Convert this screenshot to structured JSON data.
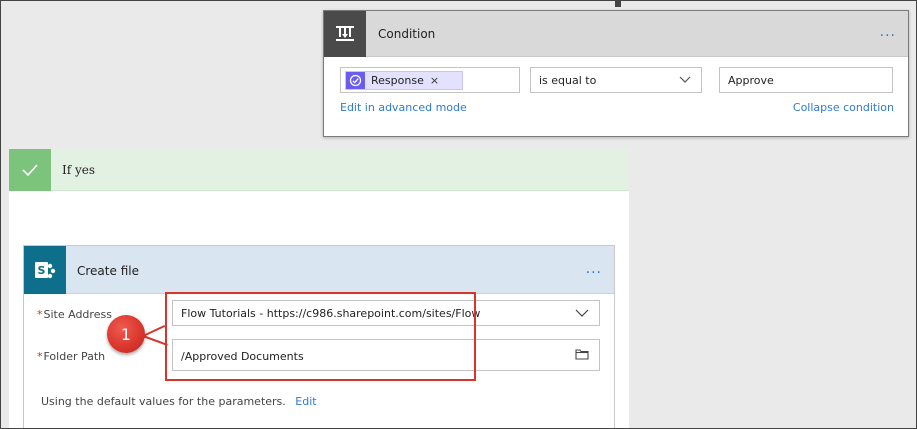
{
  "condition": {
    "title": "Condition",
    "token_label": "Response",
    "token_remove": "×",
    "operator": "is equal to",
    "value": "Approve",
    "edit_advanced_link": "Edit in advanced mode",
    "collapse_link": "Collapse condition",
    "more": "..."
  },
  "if_yes": {
    "label": "If yes"
  },
  "create_file": {
    "title": "Create file",
    "more": "...",
    "site_address_label": "Site Address",
    "site_address_value": "Flow Tutorials - https://c986.sharepoint.com/sites/Flow",
    "folder_path_label": "Folder Path",
    "folder_path_value": "/Approved Documents",
    "required_marker": "*",
    "defaults_note": "Using the default values for the parameters.",
    "edit_link": "Edit"
  },
  "callout": {
    "number": "1",
    "color": "#d9342b"
  },
  "colors": {
    "condition_header": "#d9d9d9",
    "ifyes_bar": "#e3f1e3",
    "ifyes_check": "#7cc47c",
    "create_header": "#d9e5f1",
    "sharepoint_icon": "#0e6f8c",
    "token": "#e3e1ff",
    "link": "#2e7bcf"
  },
  "icons": {
    "condition": "condition-icon",
    "token": "approval-icon",
    "check": "checkmark-icon",
    "sharepoint": "sharepoint-icon",
    "chevron": "chevron-down-icon",
    "folder": "folder-icon"
  }
}
